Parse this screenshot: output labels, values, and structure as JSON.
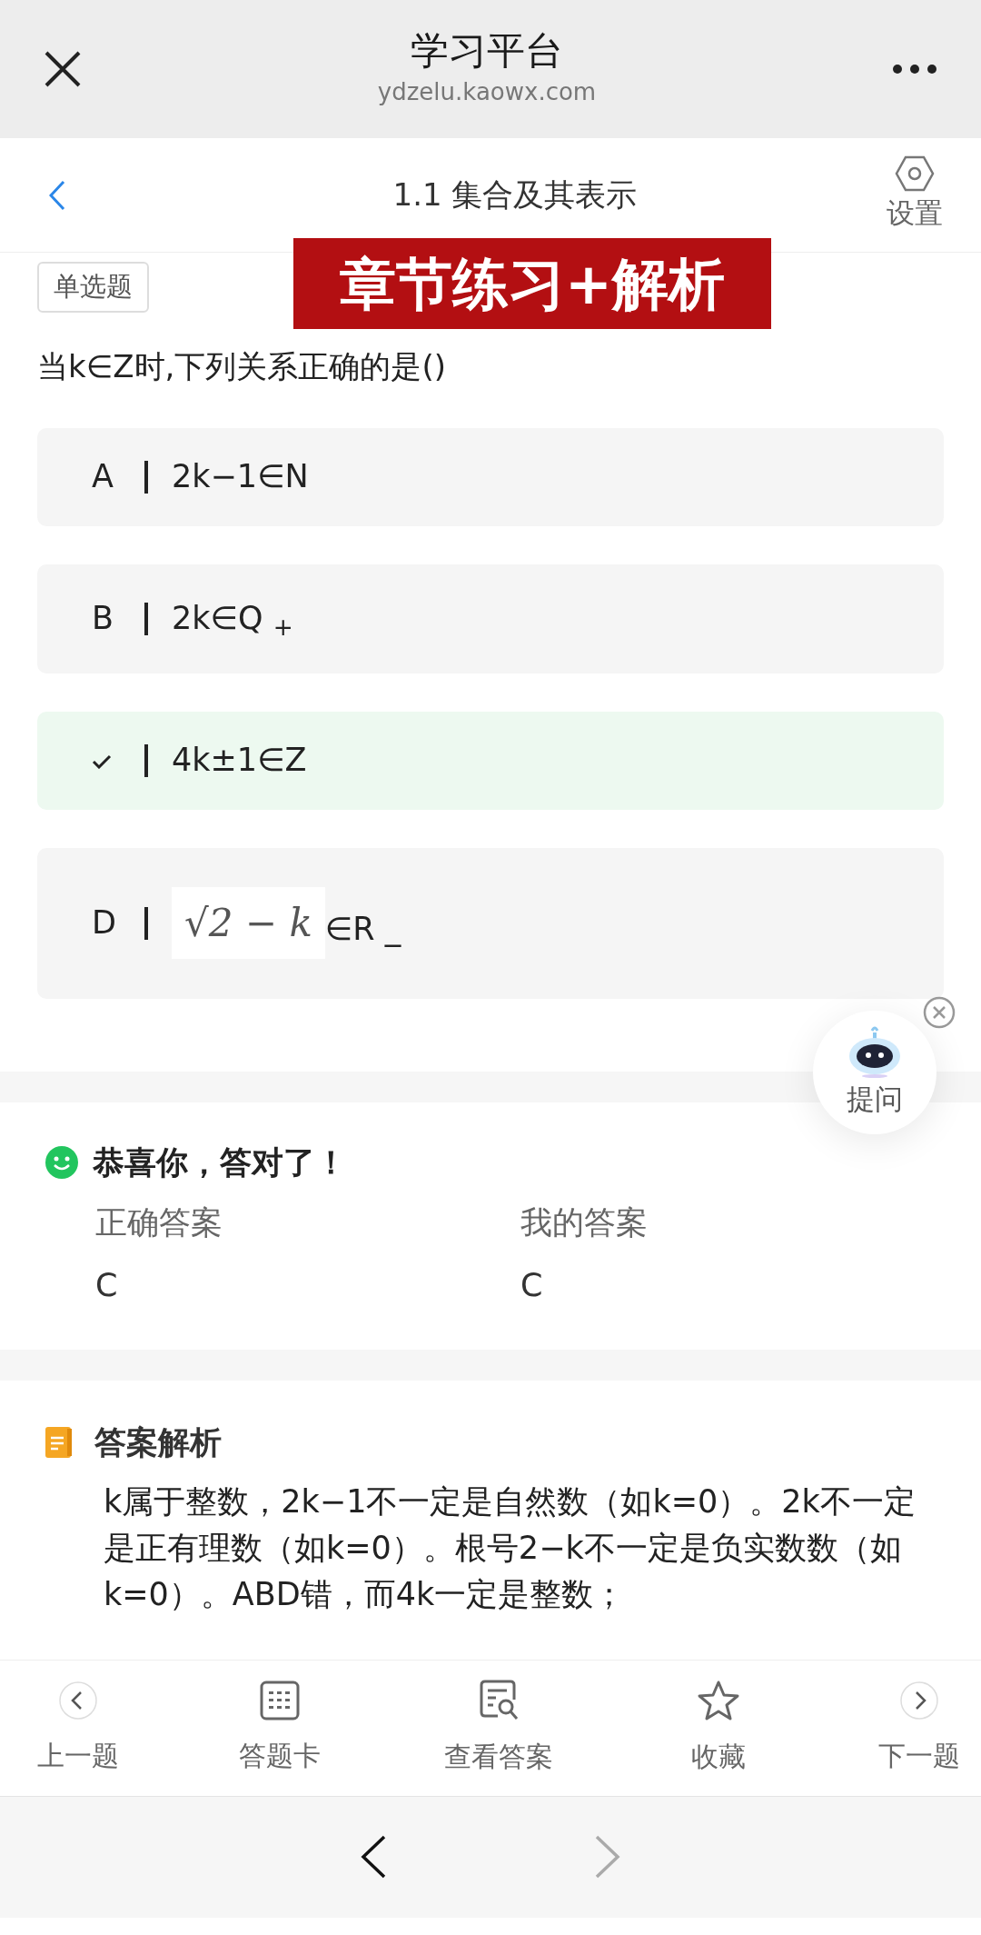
{
  "browser": {
    "title": "学习平台",
    "url": "ydzelu.kaowx.com"
  },
  "header": {
    "title": "1.1 集合及其表示",
    "settings_label": "设置"
  },
  "banner": "章节练习+解析",
  "question": {
    "type_tag": "单选题",
    "text": "当k∈Z时,下列关系正确的是()"
  },
  "options": [
    {
      "kind": "text",
      "label": "A",
      "text": "2k−1∈N",
      "correct": false
    },
    {
      "kind": "text",
      "label": "B",
      "text": "2k∈Q $_{+}$",
      "correct": false
    },
    {
      "kind": "text",
      "text": "4k±1∈Z",
      "correct": true
    },
    {
      "kind": "formula",
      "label": "D",
      "formula": "√2 − k",
      "text": "∈R _",
      "correct": false
    }
  ],
  "ask_bubble": {
    "label": "提问"
  },
  "result": {
    "message": "恭喜你，答对了！",
    "correct_label": "正确答案",
    "correct_value": "C",
    "mine_label": "我的答案",
    "mine_value": "C"
  },
  "analysis": {
    "title": "答案解析",
    "text": "k属于整数，2k−1不一定是自然数（如k=0）。2k不一定是正有理数（如k=0）。根号2−k不一定是负实数数（如k=0）。ABD错，而4k一定是整数；"
  },
  "toolbar": [
    {
      "kind": "prev",
      "label": "上一题"
    },
    {
      "kind": "card",
      "label": "答题卡"
    },
    {
      "kind": "answer",
      "label": "查看答案"
    },
    {
      "kind": "star",
      "label": "收藏"
    },
    {
      "kind": "next",
      "label": "下一题"
    }
  ],
  "browser_nav": {
    "back_disabled": false,
    "forward_disabled": true
  }
}
